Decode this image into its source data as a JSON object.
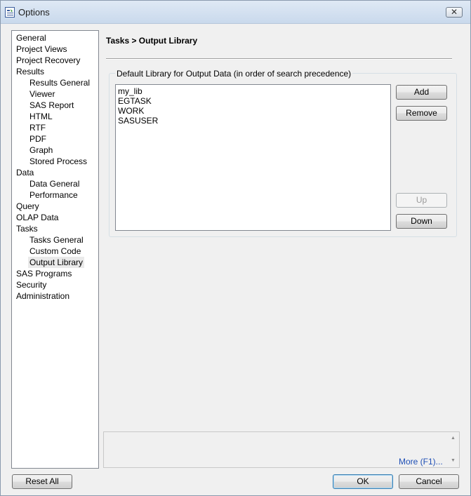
{
  "window": {
    "title": "Options",
    "close_glyph": "✕"
  },
  "nav": {
    "items": [
      {
        "label": "General",
        "level": 1,
        "name": "nav-general"
      },
      {
        "label": "Project Views",
        "level": 1,
        "name": "nav-project-views"
      },
      {
        "label": "Project Recovery",
        "level": 1,
        "name": "nav-project-recovery"
      },
      {
        "label": "Results",
        "level": 1,
        "name": "nav-results"
      },
      {
        "label": "Results General",
        "level": 2,
        "name": "nav-results-general"
      },
      {
        "label": "Viewer",
        "level": 2,
        "name": "nav-viewer"
      },
      {
        "label": "SAS Report",
        "level": 2,
        "name": "nav-sas-report"
      },
      {
        "label": "HTML",
        "level": 2,
        "name": "nav-html"
      },
      {
        "label": "RTF",
        "level": 2,
        "name": "nav-rtf"
      },
      {
        "label": "PDF",
        "level": 2,
        "name": "nav-pdf"
      },
      {
        "label": "Graph",
        "level": 2,
        "name": "nav-graph"
      },
      {
        "label": "Stored Process",
        "level": 2,
        "name": "nav-stored-process"
      },
      {
        "label": "Data",
        "level": 1,
        "name": "nav-data"
      },
      {
        "label": "Data General",
        "level": 2,
        "name": "nav-data-general"
      },
      {
        "label": "Performance",
        "level": 2,
        "name": "nav-performance"
      },
      {
        "label": "Query",
        "level": 1,
        "name": "nav-query"
      },
      {
        "label": "OLAP Data",
        "level": 1,
        "name": "nav-olap-data"
      },
      {
        "label": "Tasks",
        "level": 1,
        "name": "nav-tasks"
      },
      {
        "label": "Tasks General",
        "level": 2,
        "name": "nav-tasks-general"
      },
      {
        "label": "Custom Code",
        "level": 2,
        "name": "nav-custom-code"
      },
      {
        "label": "Output Library",
        "level": 2,
        "name": "nav-output-library",
        "selected": true
      },
      {
        "label": "SAS Programs",
        "level": 1,
        "name": "nav-sas-programs"
      },
      {
        "label": "Security",
        "level": 1,
        "name": "nav-security"
      },
      {
        "label": "Administration",
        "level": 1,
        "name": "nav-administration"
      }
    ]
  },
  "main": {
    "title": "Tasks > Output Library",
    "group_label": "Default Library for Output Data (in order of search precedence)",
    "libraries": [
      "my_lib",
      "EGTASK",
      "WORK",
      "SASUSER"
    ],
    "buttons": {
      "add": "Add",
      "remove": "Remove",
      "up": "Up",
      "down": "Down"
    }
  },
  "help": {
    "more_link": "More (F1)..."
  },
  "footer": {
    "reset_all": "Reset All",
    "ok": "OK",
    "cancel": "Cancel"
  }
}
